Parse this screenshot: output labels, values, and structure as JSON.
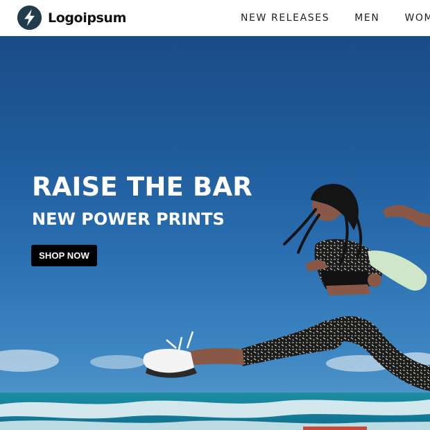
{
  "header": {
    "logo": {
      "text": "Logoipsum",
      "icon": "bolt-icon"
    },
    "nav": [
      {
        "label": "NEW RELEASES"
      },
      {
        "label": "MEN"
      },
      {
        "label": "WOMEN"
      }
    ]
  },
  "hero": {
    "title": "RAISE THE BAR",
    "subtitle": "NEW POWER PRINTS",
    "cta_label": "SHOP NOW"
  },
  "colors": {
    "sky": "#1f5c9c",
    "sea": "#1e8fa3",
    "logo_mark": "#1f3a4a",
    "button": "#000000"
  }
}
